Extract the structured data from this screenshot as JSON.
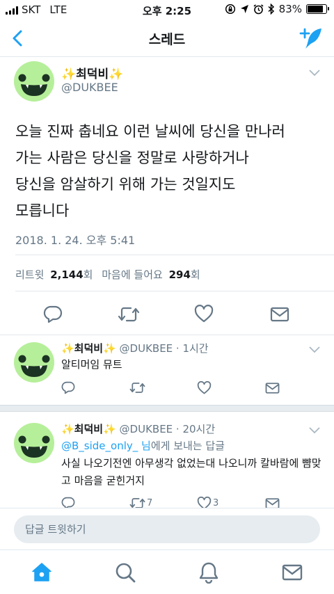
{
  "status": {
    "carrier": "SKT",
    "network": "LTE",
    "time": "오후 2:25",
    "battery": "83%",
    "battery_level": 0.83,
    "icons": [
      "rotation-lock-icon",
      "location-icon",
      "alarm-icon",
      "bluetooth-icon",
      "battery-icon"
    ]
  },
  "nav": {
    "title": "스레드",
    "back_icon": "chevron-left-icon",
    "compose_icon": "compose-tweet-icon"
  },
  "main_tweet": {
    "name": "✨최덕비✨",
    "handle": "@DUKBEE",
    "lines": [
      "오늘 진짜 춥네요 이런 날씨에 당신을 만나러",
      "가는 사람은 당신을 정말로 사랑하거나",
      "당신을 암살하기 위해 가는 것일지도",
      "모릅니다"
    ],
    "timestamp": "2018. 1. 24. 오후 5:41",
    "retweets_label": "리트윗",
    "retweets_count": "2,144",
    "retweets_unit": "회",
    "likes_label": "마음에 들어요",
    "likes_count": "294",
    "likes_unit": "회"
  },
  "replies": [
    {
      "name": "✨최덕비✨",
      "handle_time": "@DUKBEE · 1시간",
      "text": "알티머임 뮤트",
      "retweets": "",
      "likes": ""
    },
    {
      "name": "✨최덕비✨",
      "handle_time": "@DUKBEE · 20시간",
      "replying_link": "@B_side_only_ 님",
      "replying_suffix": "에게 보내는 답글",
      "text": "사실 나오기전엔 아무생각 없었는대 나오니까 칼바람에 뺨맞고 마음을 굳힌거지",
      "retweets": "7",
      "likes": "3"
    }
  ],
  "reply_bar": {
    "placeholder": "답글 트윗하기"
  },
  "tabs": [
    {
      "icon": "home-icon",
      "active": true
    },
    {
      "icon": "search-icon",
      "active": false
    },
    {
      "icon": "notifications-icon",
      "active": false
    },
    {
      "icon": "messages-icon",
      "active": false
    }
  ],
  "colors": {
    "accent": "#1da1f2",
    "text": "#14171a",
    "secondary": "#657786",
    "avatar_bg": "#b6ef9a"
  }
}
